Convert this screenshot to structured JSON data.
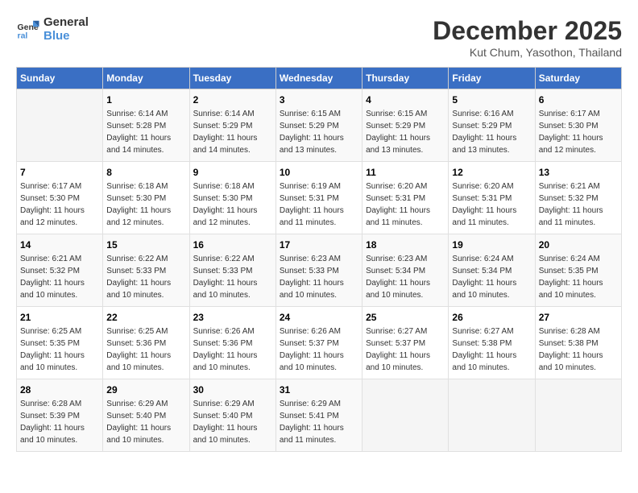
{
  "header": {
    "logo_line1": "General",
    "logo_line2": "Blue",
    "title": "December 2025",
    "subtitle": "Kut Chum, Yasothon, Thailand"
  },
  "days_of_week": [
    "Sunday",
    "Monday",
    "Tuesday",
    "Wednesday",
    "Thursday",
    "Friday",
    "Saturday"
  ],
  "weeks": [
    [
      {
        "day": "",
        "info": ""
      },
      {
        "day": "1",
        "info": "Sunrise: 6:14 AM\nSunset: 5:28 PM\nDaylight: 11 hours\nand 14 minutes."
      },
      {
        "day": "2",
        "info": "Sunrise: 6:14 AM\nSunset: 5:29 PM\nDaylight: 11 hours\nand 14 minutes."
      },
      {
        "day": "3",
        "info": "Sunrise: 6:15 AM\nSunset: 5:29 PM\nDaylight: 11 hours\nand 13 minutes."
      },
      {
        "day": "4",
        "info": "Sunrise: 6:15 AM\nSunset: 5:29 PM\nDaylight: 11 hours\nand 13 minutes."
      },
      {
        "day": "5",
        "info": "Sunrise: 6:16 AM\nSunset: 5:29 PM\nDaylight: 11 hours\nand 13 minutes."
      },
      {
        "day": "6",
        "info": "Sunrise: 6:17 AM\nSunset: 5:30 PM\nDaylight: 11 hours\nand 12 minutes."
      }
    ],
    [
      {
        "day": "7",
        "info": "Sunrise: 6:17 AM\nSunset: 5:30 PM\nDaylight: 11 hours\nand 12 minutes."
      },
      {
        "day": "8",
        "info": "Sunrise: 6:18 AM\nSunset: 5:30 PM\nDaylight: 11 hours\nand 12 minutes."
      },
      {
        "day": "9",
        "info": "Sunrise: 6:18 AM\nSunset: 5:30 PM\nDaylight: 11 hours\nand 12 minutes."
      },
      {
        "day": "10",
        "info": "Sunrise: 6:19 AM\nSunset: 5:31 PM\nDaylight: 11 hours\nand 11 minutes."
      },
      {
        "day": "11",
        "info": "Sunrise: 6:20 AM\nSunset: 5:31 PM\nDaylight: 11 hours\nand 11 minutes."
      },
      {
        "day": "12",
        "info": "Sunrise: 6:20 AM\nSunset: 5:31 PM\nDaylight: 11 hours\nand 11 minutes."
      },
      {
        "day": "13",
        "info": "Sunrise: 6:21 AM\nSunset: 5:32 PM\nDaylight: 11 hours\nand 11 minutes."
      }
    ],
    [
      {
        "day": "14",
        "info": "Sunrise: 6:21 AM\nSunset: 5:32 PM\nDaylight: 11 hours\nand 10 minutes."
      },
      {
        "day": "15",
        "info": "Sunrise: 6:22 AM\nSunset: 5:33 PM\nDaylight: 11 hours\nand 10 minutes."
      },
      {
        "day": "16",
        "info": "Sunrise: 6:22 AM\nSunset: 5:33 PM\nDaylight: 11 hours\nand 10 minutes."
      },
      {
        "day": "17",
        "info": "Sunrise: 6:23 AM\nSunset: 5:33 PM\nDaylight: 11 hours\nand 10 minutes."
      },
      {
        "day": "18",
        "info": "Sunrise: 6:23 AM\nSunset: 5:34 PM\nDaylight: 11 hours\nand 10 minutes."
      },
      {
        "day": "19",
        "info": "Sunrise: 6:24 AM\nSunset: 5:34 PM\nDaylight: 11 hours\nand 10 minutes."
      },
      {
        "day": "20",
        "info": "Sunrise: 6:24 AM\nSunset: 5:35 PM\nDaylight: 11 hours\nand 10 minutes."
      }
    ],
    [
      {
        "day": "21",
        "info": "Sunrise: 6:25 AM\nSunset: 5:35 PM\nDaylight: 11 hours\nand 10 minutes."
      },
      {
        "day": "22",
        "info": "Sunrise: 6:25 AM\nSunset: 5:36 PM\nDaylight: 11 hours\nand 10 minutes."
      },
      {
        "day": "23",
        "info": "Sunrise: 6:26 AM\nSunset: 5:36 PM\nDaylight: 11 hours\nand 10 minutes."
      },
      {
        "day": "24",
        "info": "Sunrise: 6:26 AM\nSunset: 5:37 PM\nDaylight: 11 hours\nand 10 minutes."
      },
      {
        "day": "25",
        "info": "Sunrise: 6:27 AM\nSunset: 5:37 PM\nDaylight: 11 hours\nand 10 minutes."
      },
      {
        "day": "26",
        "info": "Sunrise: 6:27 AM\nSunset: 5:38 PM\nDaylight: 11 hours\nand 10 minutes."
      },
      {
        "day": "27",
        "info": "Sunrise: 6:28 AM\nSunset: 5:38 PM\nDaylight: 11 hours\nand 10 minutes."
      }
    ],
    [
      {
        "day": "28",
        "info": "Sunrise: 6:28 AM\nSunset: 5:39 PM\nDaylight: 11 hours\nand 10 minutes."
      },
      {
        "day": "29",
        "info": "Sunrise: 6:29 AM\nSunset: 5:40 PM\nDaylight: 11 hours\nand 10 minutes."
      },
      {
        "day": "30",
        "info": "Sunrise: 6:29 AM\nSunset: 5:40 PM\nDaylight: 11 hours\nand 10 minutes."
      },
      {
        "day": "31",
        "info": "Sunrise: 6:29 AM\nSunset: 5:41 PM\nDaylight: 11 hours\nand 11 minutes."
      },
      {
        "day": "",
        "info": ""
      },
      {
        "day": "",
        "info": ""
      },
      {
        "day": "",
        "info": ""
      }
    ]
  ]
}
